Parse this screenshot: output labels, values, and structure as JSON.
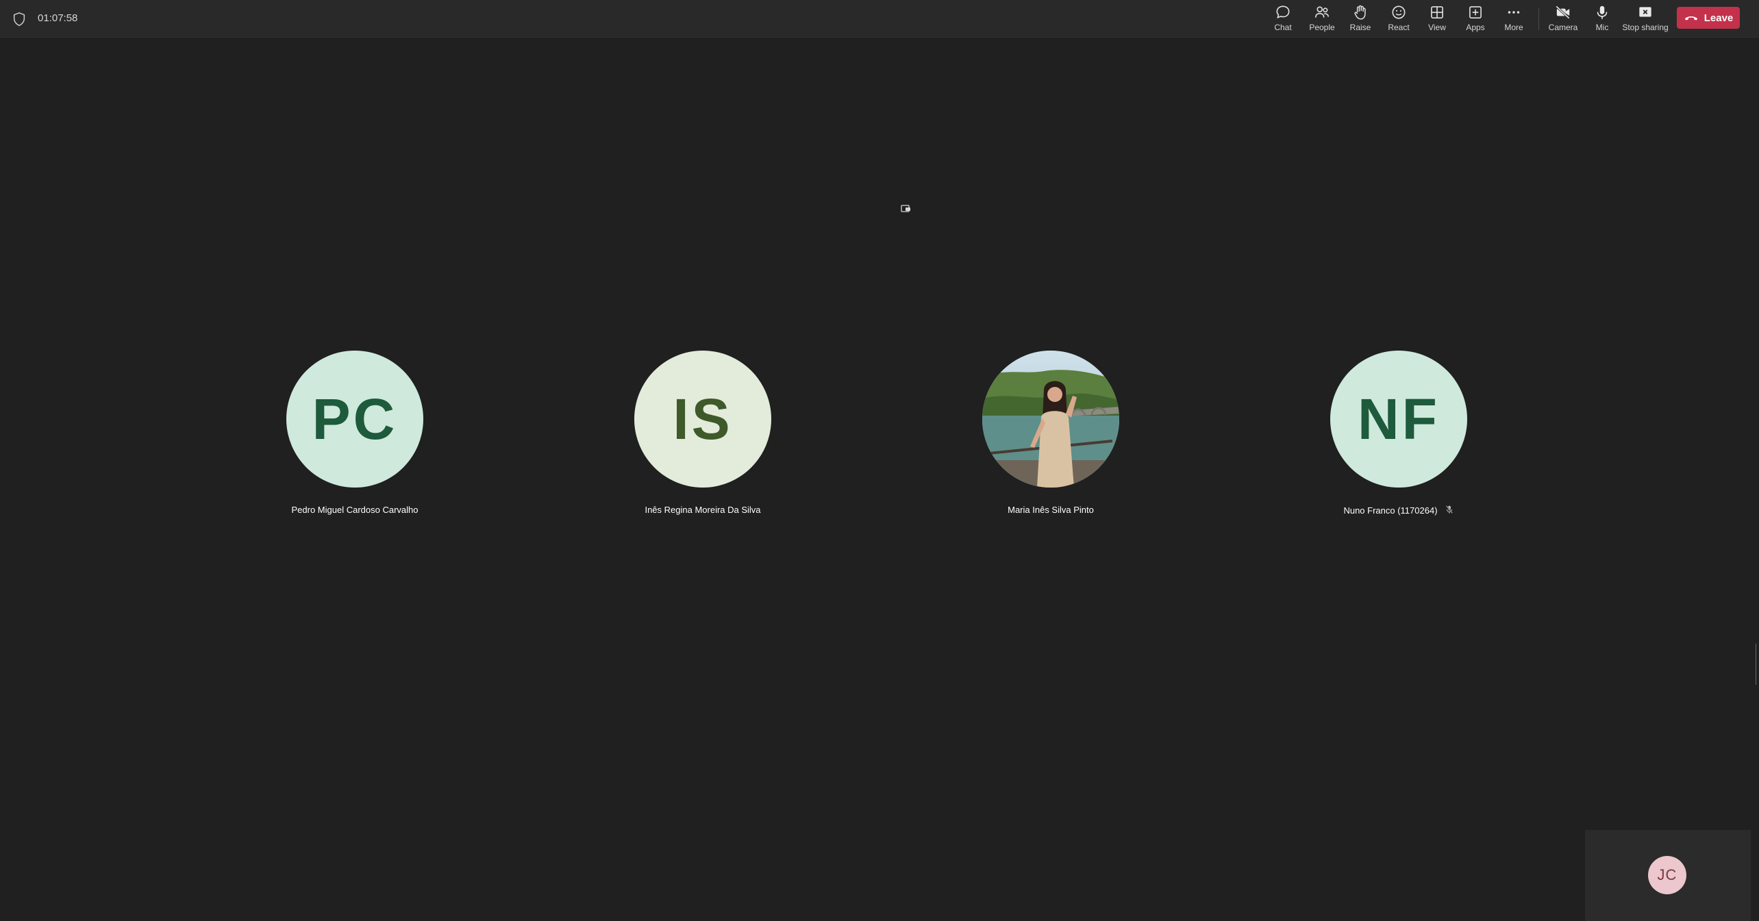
{
  "meeting": {
    "elapsed_time": "01:07:58"
  },
  "toolbar": {
    "chat": "Chat",
    "people": "People",
    "raise": "Raise",
    "react": "React",
    "view": "View",
    "apps": "Apps",
    "more": "More",
    "camera": "Camera",
    "mic": "Mic",
    "stop_sharing": "Stop sharing",
    "leave": "Leave"
  },
  "participants": [
    {
      "initials": "PC",
      "name": "Pedro Miguel Cardoso Carvalho",
      "avatar_bg": "#cfe9dd",
      "avatar_fg": "#1e5a3c",
      "muted": false
    },
    {
      "initials": "IS",
      "name": "Inês Regina Moreira Da Silva",
      "avatar_bg": "#e3ecdb",
      "avatar_fg": "#3f5a2a",
      "muted": false
    },
    {
      "initials": "",
      "name": "Maria Inês Silva Pinto",
      "avatar_bg": "#7aa0a0",
      "avatar_fg": "#ffffff",
      "muted": false,
      "photo": true
    },
    {
      "initials": "NF",
      "name": "Nuno Franco (1170264)",
      "avatar_bg": "#cfe9dd",
      "avatar_fg": "#1e5a3c",
      "muted": true
    }
  ],
  "self_view": {
    "initials": "JC"
  },
  "colors": {
    "background": "#202020",
    "topbar": "#292929",
    "leave": "#c4314b"
  }
}
